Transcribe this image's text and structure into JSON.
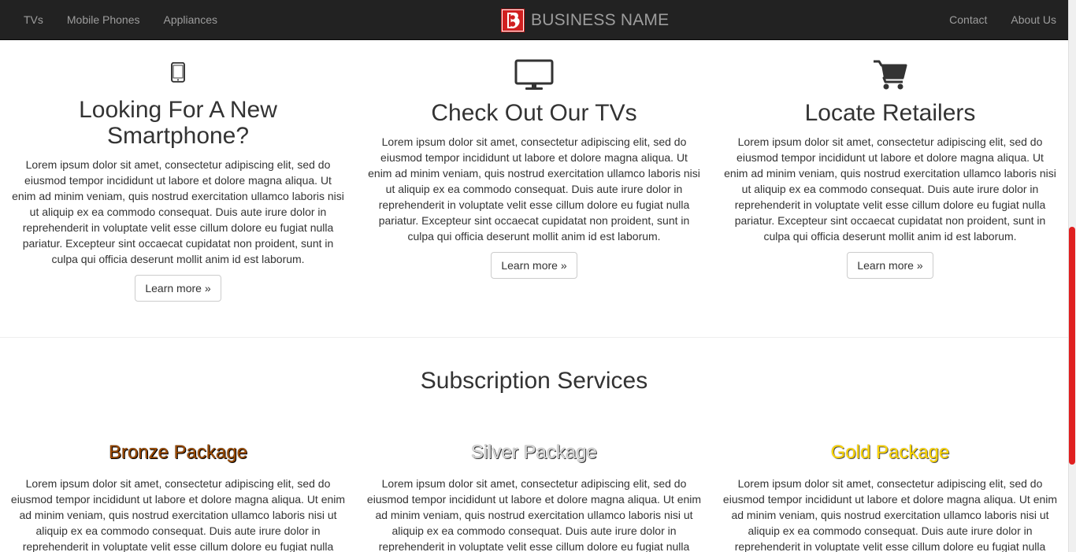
{
  "navbar": {
    "left_links": [
      {
        "label": "TVs"
      },
      {
        "label": "Mobile Phones"
      },
      {
        "label": "Appliances"
      }
    ],
    "brand": {
      "name": "BUSINESS NAME",
      "logo_icon": "b-logo-icon",
      "logo_color": "#d01f1f"
    },
    "right_links": [
      {
        "label": "Contact"
      },
      {
        "label": "About Us"
      }
    ]
  },
  "features": [
    {
      "icon": "smartphone-icon",
      "title_line1": "Looking For A New",
      "title_line2": "Smartphone?",
      "body": "Lorem ipsum dolor sit amet, consectetur adipiscing elit, sed do eiusmod tempor incididunt ut labore et dolore magna aliqua. Ut enim ad minim veniam, quis nostrud exercitation ullamco laboris nisi ut aliquip ex ea commodo consequat. Duis aute irure dolor in reprehenderit in voluptate velit esse cillum dolore eu fugiat nulla pariatur. Excepteur sint occaecat cupidatat non proident, sunt in culpa qui officia deserunt mollit anim id est laborum.",
      "button": "Learn more »"
    },
    {
      "icon": "monitor-icon",
      "title_line1": "Check Out Our TVs",
      "title_line2": "",
      "body": "Lorem ipsum dolor sit amet, consectetur adipiscing elit, sed do eiusmod tempor incididunt ut labore et dolore magna aliqua. Ut enim ad minim veniam, quis nostrud exercitation ullamco laboris nisi ut aliquip ex ea commodo consequat. Duis aute irure dolor in reprehenderit in voluptate velit esse cillum dolore eu fugiat nulla pariatur. Excepteur sint occaecat cupidatat non proident, sunt in culpa qui officia deserunt mollit anim id est laborum.",
      "button": "Learn more »"
    },
    {
      "icon": "shopping-cart-icon",
      "title_line1": "Locate Retailers",
      "title_line2": "",
      "body": "Lorem ipsum dolor sit amet, consectetur adipiscing elit, sed do eiusmod tempor incididunt ut labore et dolore magna aliqua. Ut enim ad minim veniam, quis nostrud exercitation ullamco laboris nisi ut aliquip ex ea commodo consequat. Duis aute irure dolor in reprehenderit in voluptate velit esse cillum dolore eu fugiat nulla pariatur. Excepteur sint occaecat cupidatat non proident, sunt in culpa qui officia deserunt mollit anim id est laborum.",
      "button": "Learn more »"
    }
  ],
  "subscriptions": {
    "title": "Subscription Services",
    "packages": [
      {
        "name": "Bronze Package",
        "color": "#9c4a00",
        "body": "Lorem ipsum dolor sit amet, consectetur adipiscing elit, sed do eiusmod tempor incididunt ut labore et dolore magna aliqua. Ut enim ad minim veniam, quis nostrud exercitation ullamco laboris nisi ut aliquip ex ea commodo consequat. Duis aute irure dolor in reprehenderit in voluptate velit esse cillum dolore eu fugiat nulla"
      },
      {
        "name": "Silver Package",
        "color": "#d8d8d8",
        "body": "Lorem ipsum dolor sit amet, consectetur adipiscing elit, sed do eiusmod tempor incididunt ut labore et dolore magna aliqua. Ut enim ad minim veniam, quis nostrud exercitation ullamco laboris nisi ut aliquip ex ea commodo consequat. Duis aute irure dolor in reprehenderit in voluptate velit esse cillum dolore eu fugiat nulla"
      },
      {
        "name": "Gold Package",
        "color": "#ffd700",
        "body": "Lorem ipsum dolor sit amet, consectetur adipiscing elit, sed do eiusmod tempor incididunt ut labore et dolore magna aliqua. Ut enim ad minim veniam, quis nostrud exercitation ullamco laboris nisi ut aliquip ex ea commodo consequat. Duis aute irure dolor in reprehenderit in voluptate velit esse cillum dolore eu fugiat nulla"
      }
    ]
  },
  "scrollbar": {
    "thumb_color": "#e02020"
  }
}
